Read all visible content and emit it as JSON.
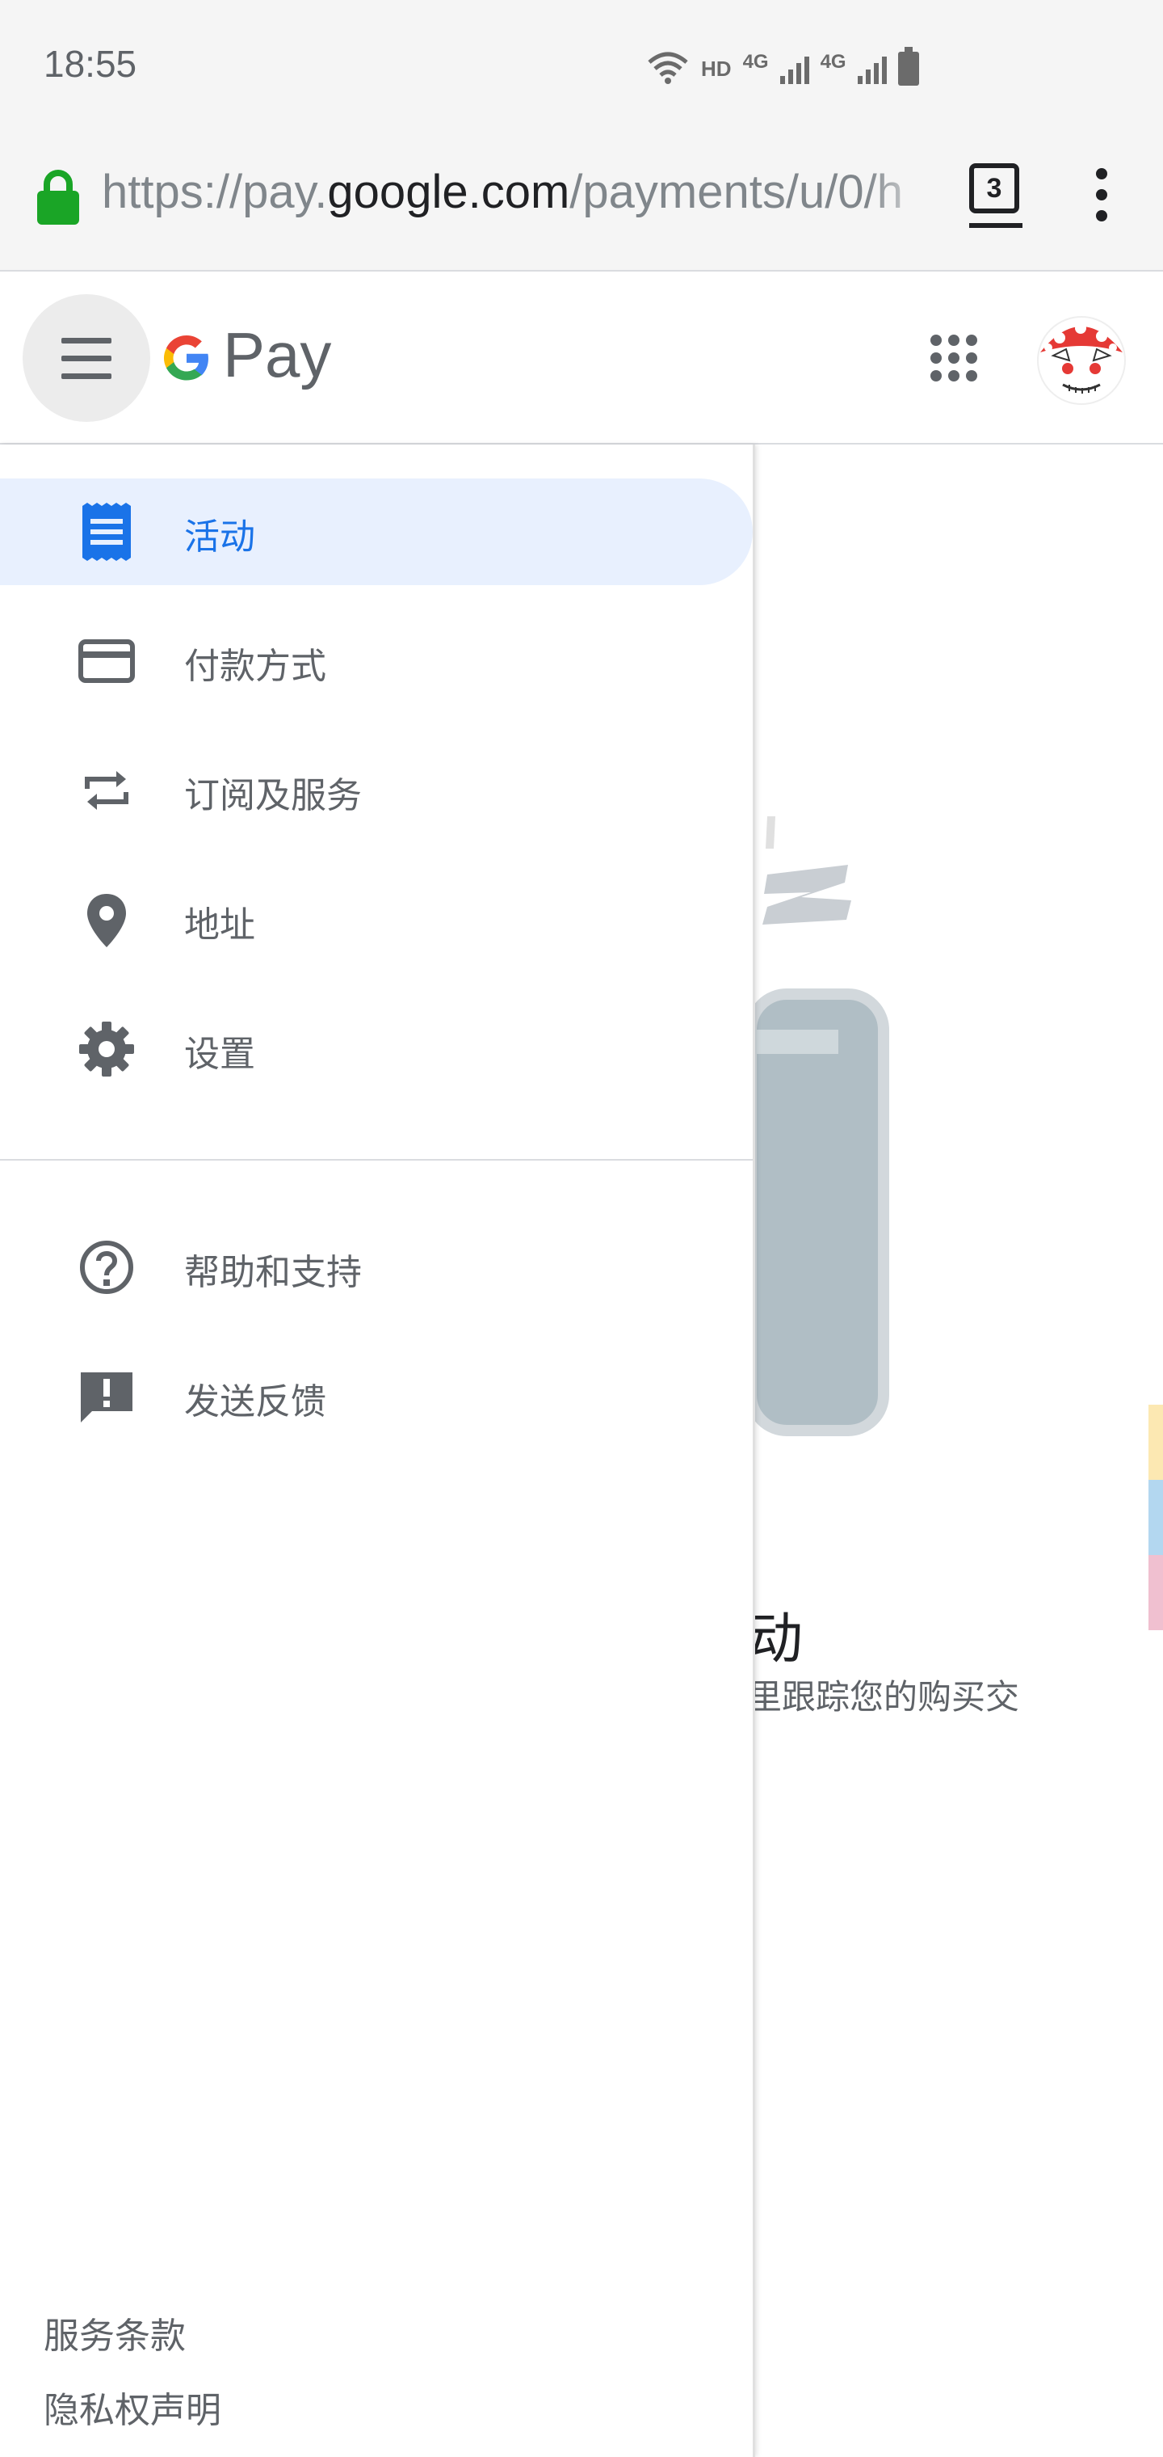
{
  "status_bar": {
    "time": "18:55",
    "hd": "HD",
    "net1": "4G",
    "net2": "4G"
  },
  "browser": {
    "url_scheme": "https://pay.",
    "url_host": "google.com",
    "url_path": "/payments/u/0/h",
    "tab_count": "3"
  },
  "header": {
    "brand": "Pay"
  },
  "drawer": {
    "items": [
      {
        "label": "活动",
        "icon": "receipt-icon",
        "active": true
      },
      {
        "label": "付款方式",
        "icon": "credit-card-icon"
      },
      {
        "label": "订阅及服务",
        "icon": "repeat-icon"
      },
      {
        "label": "地址",
        "icon": "location-pin-icon"
      },
      {
        "label": "设置",
        "icon": "gear-icon"
      }
    ],
    "secondary_items": [
      {
        "label": "帮助和支持",
        "icon": "help-circle-icon"
      },
      {
        "label": "发送反馈",
        "icon": "feedback-icon"
      }
    ],
    "footer": {
      "terms": "服务条款",
      "privacy": "隐私权声明"
    }
  },
  "background": {
    "title_fragment": "动",
    "desc_fragment": "里跟踪您的购买交"
  },
  "colors": {
    "accent": "#1a73e8",
    "active_bg": "#e8f0fe",
    "icon_gray": "#5f6368",
    "lock_green": "#34a853"
  }
}
